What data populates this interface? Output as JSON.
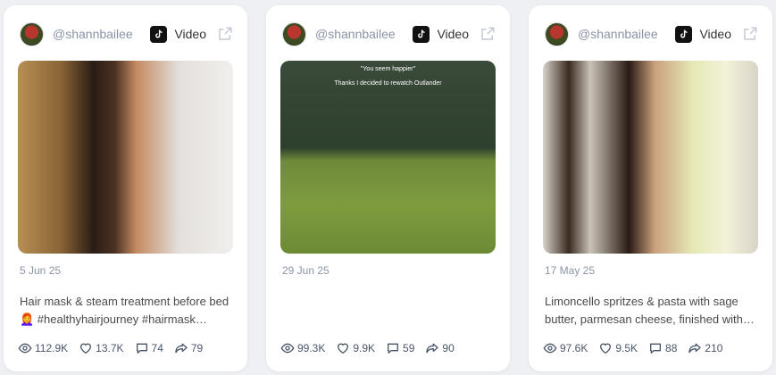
{
  "cards": [
    {
      "handle": "@shannbailee",
      "type_label": "Video",
      "date": "5 Jun 25",
      "caption_line1": "Hair mask & steam treatment before bed",
      "caption_line2": "👩‍🦰 #healthyhairjourney #hairmask…",
      "overlay_line1": "",
      "overlay_line2": "",
      "stats": {
        "views": "112.9K",
        "likes": "13.7K",
        "comments": "74",
        "shares": "79"
      }
    },
    {
      "handle": "@shannbailee",
      "type_label": "Video",
      "date": "29 Jun 25",
      "caption_line1": "",
      "caption_line2": "",
      "overlay_line1": "\"You seem happier\"",
      "overlay_line2": "Thanks I decided to rewatch Outlander",
      "stats": {
        "views": "99.3K",
        "likes": "9.9K",
        "comments": "59",
        "shares": "90"
      }
    },
    {
      "handle": "@shannbailee",
      "type_label": "Video",
      "date": "17 May 25",
      "caption_line1": "Limoncello spritzes & pasta with sage",
      "caption_line2": "butter, parmesan cheese, finished with…",
      "overlay_line1": "",
      "overlay_line2": "",
      "stats": {
        "views": "97.6K",
        "likes": "9.5K",
        "comments": "88",
        "shares": "210"
      }
    }
  ],
  "icons": {
    "platform": "tiktok-icon",
    "external": "external-link-icon",
    "views": "eye-icon",
    "likes": "heart-icon",
    "comments": "comment-icon",
    "shares": "share-icon"
  },
  "colors": {
    "muted": "#8a93a6",
    "text": "#4a4a4a",
    "background": "#eef0f4"
  }
}
